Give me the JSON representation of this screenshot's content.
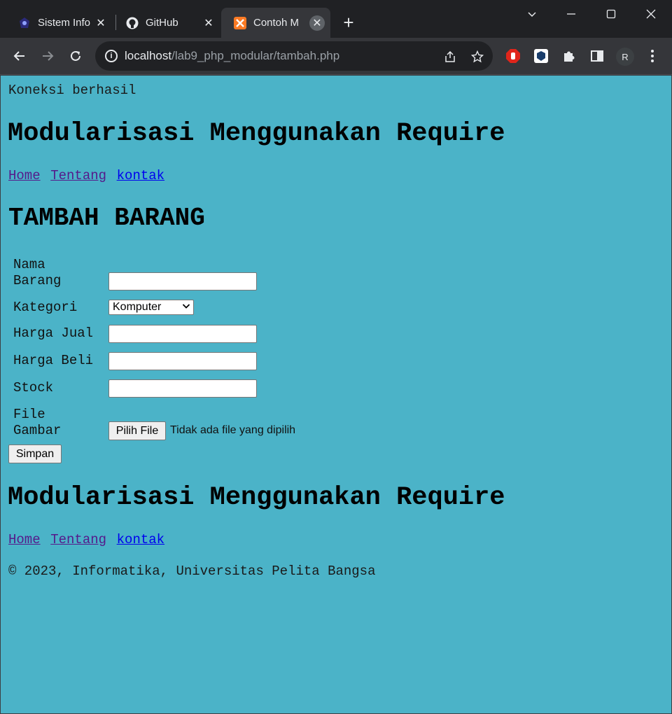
{
  "browser": {
    "tabs": [
      {
        "title": "Sistem Info",
        "active": false
      },
      {
        "title": "GitHub",
        "active": false
      },
      {
        "title": "Contoh M",
        "active": true
      }
    ],
    "url_host": "localhost",
    "url_path": "/lab9_php_modular/tambah.php",
    "profile_initial": "R",
    "close_glyph": "✕",
    "newtab_glyph": "+"
  },
  "page": {
    "status_message": "Koneksi berhasil",
    "header_title": "Modularisasi Menggunakan Require",
    "nav": [
      {
        "label": "Home"
      },
      {
        "label": "Tentang"
      },
      {
        "label": "kontak"
      }
    ],
    "form_title": "TAMBAH BARANG",
    "form": {
      "nama_label": "Nama Barang",
      "kategori_label": "Kategori",
      "kategori_selected": "Komputer",
      "harga_jual_label": "Harga Jual",
      "harga_beli_label": "Harga Beli",
      "stock_label": "Stock",
      "file_label": "File Gambar",
      "file_button": "Pilih File",
      "file_status": "Tidak ada file yang dipilih",
      "submit_label": "Simpan"
    },
    "footer_title": "Modularisasi Menggunakan Require",
    "footer_nav": [
      {
        "label": "Home"
      },
      {
        "label": "Tentang"
      },
      {
        "label": "kontak"
      }
    ],
    "copyright": "© 2023, Informatika, Universitas Pelita Bangsa"
  },
  "colors": {
    "page_background": "#4bb3c8",
    "visited_link": "#551a8b",
    "unvisited_link": "#0000ee"
  }
}
